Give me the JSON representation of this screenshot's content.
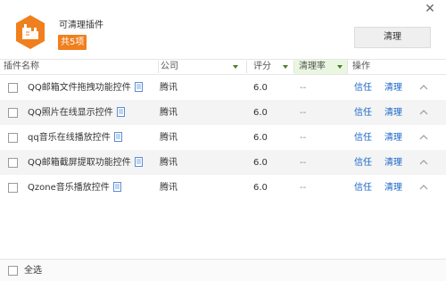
{
  "header": {
    "title": "可清理插件",
    "count_badge": "共5项",
    "clean_button": "清理",
    "close_glyph": "✕",
    "brand_color": "#f07f1e"
  },
  "columns": {
    "name": "插件名称",
    "company": "公司",
    "score": "评分",
    "rate": "清理率",
    "action": "操作"
  },
  "rows": [
    {
      "name": "QQ邮箱文件拖拽功能控件",
      "company": "腾讯",
      "score": "6.0",
      "rate": "--",
      "trust": "信任",
      "clean": "清理"
    },
    {
      "name": "QQ照片在线显示控件",
      "company": "腾讯",
      "score": "6.0",
      "rate": "--",
      "trust": "信任",
      "clean": "清理"
    },
    {
      "name": "qq音乐在线播放控件",
      "company": "腾讯",
      "score": "6.0",
      "rate": "--",
      "trust": "信任",
      "clean": "清理"
    },
    {
      "name": "QQ邮箱截屏提取功能控件",
      "company": "腾讯",
      "score": "6.0",
      "rate": "--",
      "trust": "信任",
      "clean": "清理"
    },
    {
      "name": "Qzone音乐播放控件",
      "company": "腾讯",
      "score": "6.0",
      "rate": "--",
      "trust": "信任",
      "clean": "清理"
    }
  ],
  "footer": {
    "select_all": "全选"
  },
  "colors": {
    "link": "#1a66c8",
    "sort_highlight": "#eaf7e0"
  }
}
